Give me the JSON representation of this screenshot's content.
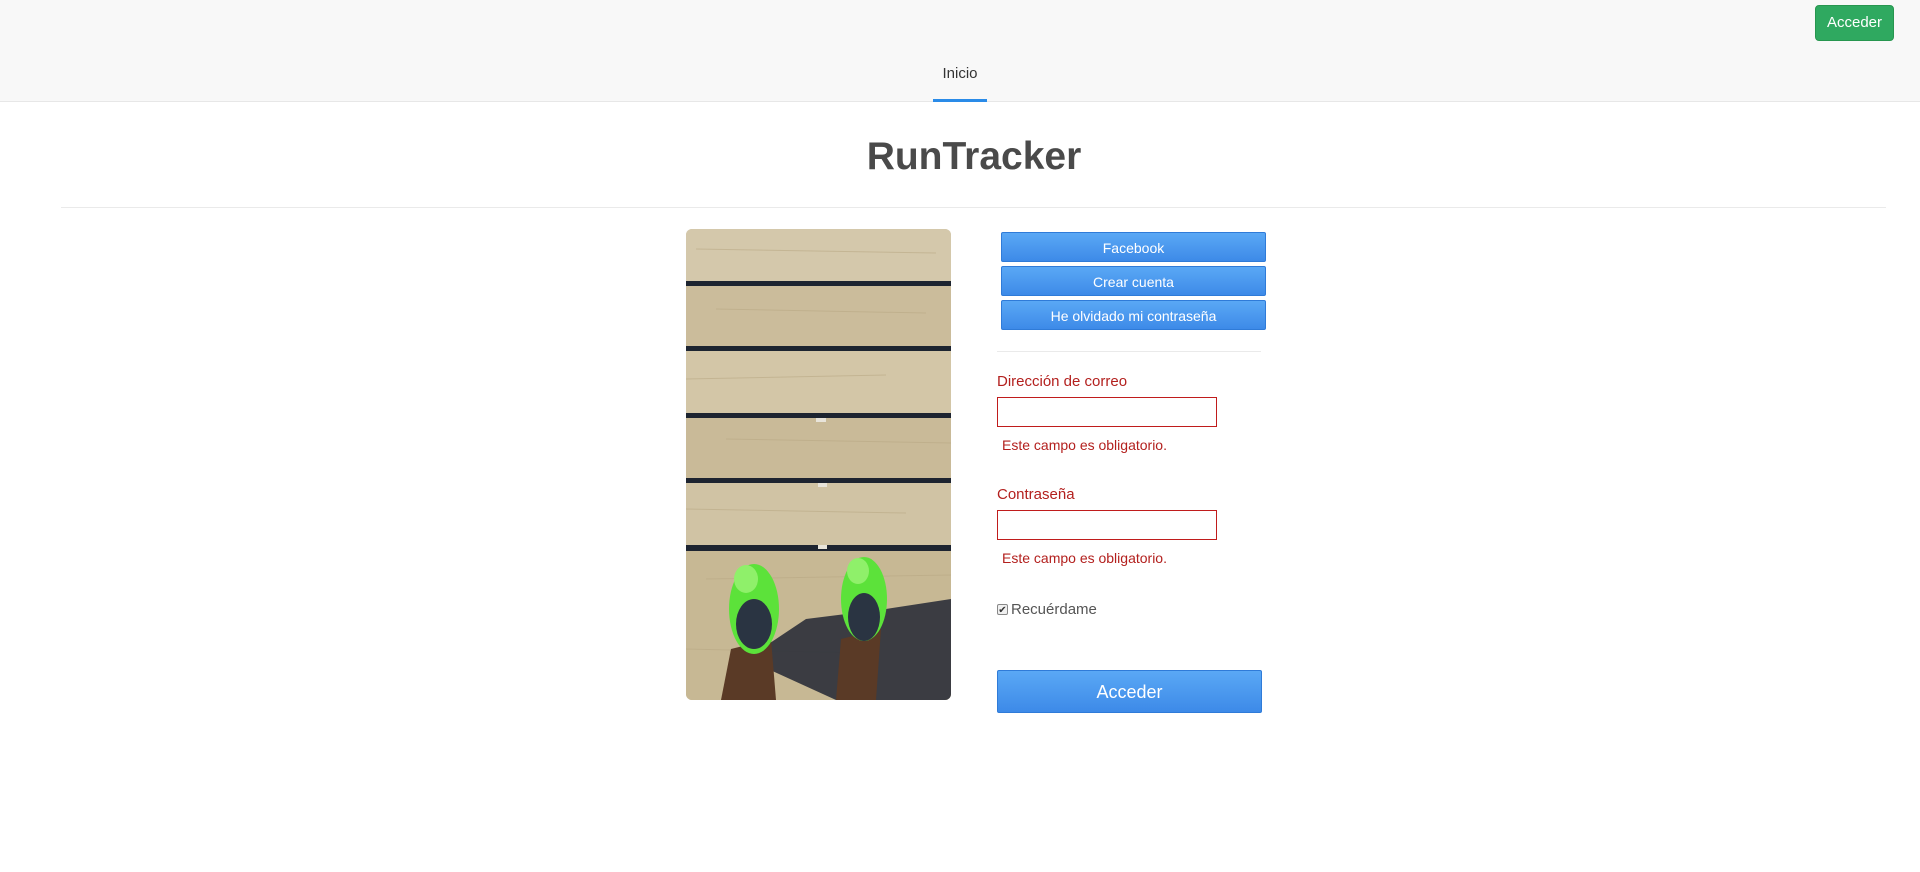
{
  "nav": {
    "login_label": "Acceder",
    "tabs": [
      {
        "label": "Inicio",
        "active": true
      }
    ],
    "accent_color": "#2a8be8",
    "login_color": "#2fa960"
  },
  "header": {
    "title": "RunTracker"
  },
  "hero_image": {
    "icon": "running-shoes-on-boardwalk-photo"
  },
  "social": {
    "facebook_label": "Facebook",
    "create_account_label": "Crear cuenta",
    "forgot_password_label": "He olvidado mi contraseña"
  },
  "form": {
    "email": {
      "label": "Dirección de correo",
      "value": "",
      "error": "Este campo es obligatorio."
    },
    "password": {
      "label": "Contraseña",
      "value": "",
      "error": "Este campo es obligatorio."
    },
    "remember": {
      "label": "Recuérdame",
      "checked": true
    },
    "submit_label": "Acceder",
    "error_color": "#b3201e",
    "button_color": "#4a9aef"
  }
}
